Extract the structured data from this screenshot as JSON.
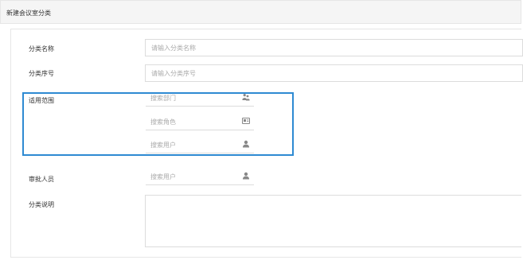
{
  "header": {
    "title": "新建会议室分类"
  },
  "form": {
    "category_name": {
      "label": "分类名称",
      "placeholder": "请输入分类名称"
    },
    "category_order": {
      "label": "分类序号",
      "placeholder": "请输入分类序号"
    },
    "scope": {
      "label": "适用范围",
      "department": {
        "placeholder": "搜索部门",
        "icon": "department-icon"
      },
      "role": {
        "placeholder": "搜索角色",
        "icon": "role-card-icon"
      },
      "user": {
        "placeholder": "搜索用户",
        "icon": "user-icon"
      }
    },
    "approver": {
      "label": "审批人员",
      "placeholder": "搜索用户",
      "icon": "user-icon"
    },
    "description": {
      "label": "分类说明"
    }
  },
  "colors": {
    "highlight": "#2e8ad2",
    "border": "#dcdcdc",
    "header_bg": "#f5f5f5"
  }
}
